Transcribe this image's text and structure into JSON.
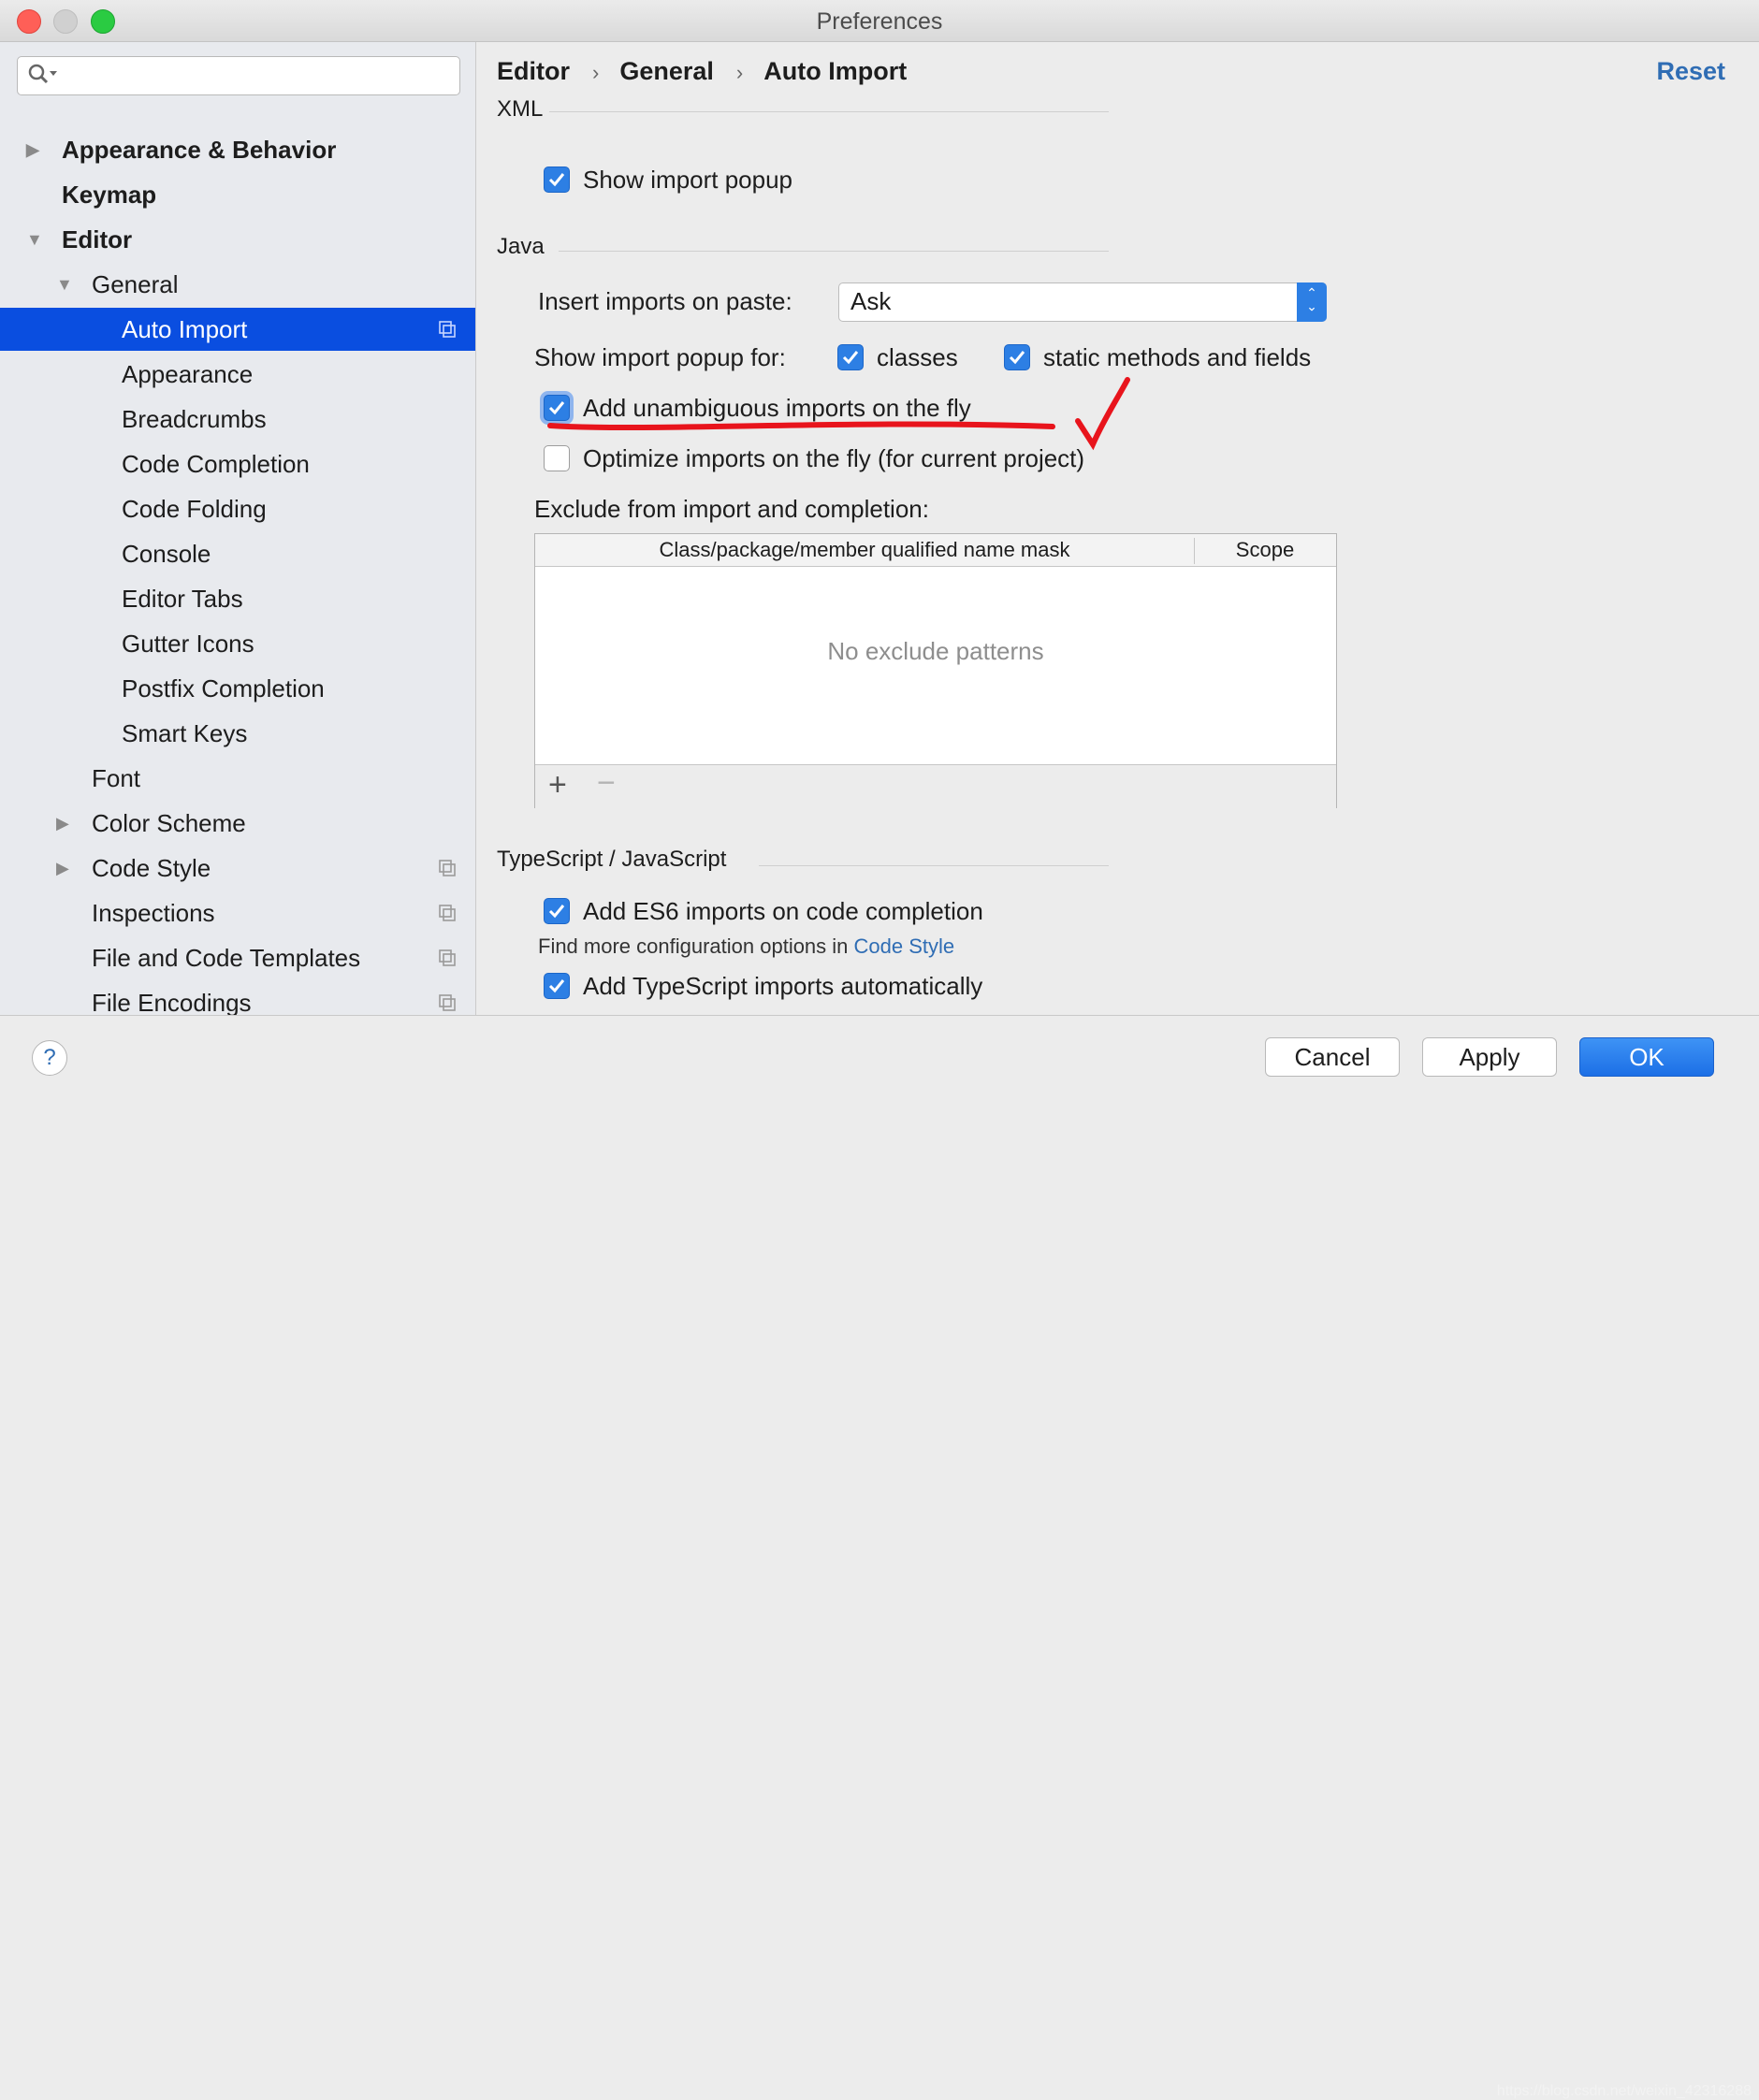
{
  "window": {
    "title": "Preferences"
  },
  "sidebar": {
    "search_placeholder": "",
    "items": [
      {
        "label": "Appearance & Behavior",
        "bold": true,
        "arrow": "right"
      },
      {
        "label": "Keymap",
        "bold": true
      },
      {
        "label": "Editor",
        "bold": true,
        "arrow": "down"
      },
      {
        "label": "General",
        "arrow": "down"
      },
      {
        "label": "Auto Import",
        "selected": true,
        "project_icon": true
      },
      {
        "label": "Appearance"
      },
      {
        "label": "Breadcrumbs"
      },
      {
        "label": "Code Completion"
      },
      {
        "label": "Code Folding"
      },
      {
        "label": "Console"
      },
      {
        "label": "Editor Tabs"
      },
      {
        "label": "Gutter Icons"
      },
      {
        "label": "Postfix Completion"
      },
      {
        "label": "Smart Keys"
      },
      {
        "label": "Font"
      },
      {
        "label": "Color Scheme",
        "arrow": "right"
      },
      {
        "label": "Code Style",
        "arrow": "right",
        "project_icon": true
      },
      {
        "label": "Inspections",
        "project_icon": true
      },
      {
        "label": "File and Code Templates",
        "project_icon": true
      },
      {
        "label": "File Encodings",
        "project_icon": true
      }
    ]
  },
  "breadcrumb": [
    "Editor",
    "General",
    "Auto Import"
  ],
  "reset_label": "Reset",
  "xml": {
    "section": "XML",
    "show_import_popup": {
      "label": "Show import popup",
      "checked": true
    }
  },
  "java": {
    "section": "Java",
    "insert_on_paste_label": "Insert imports on paste:",
    "insert_on_paste_value": "Ask",
    "popup_for_label": "Show import popup for:",
    "classes": {
      "label": "classes",
      "checked": true
    },
    "static_methods": {
      "label": "static methods and fields",
      "checked": true
    },
    "add_unambiguous": {
      "label": "Add unambiguous imports on the fly",
      "checked": true
    },
    "optimize": {
      "label": "Optimize imports on the fly (for current project)",
      "checked": false
    },
    "exclude_label": "Exclude from import and completion:",
    "table": {
      "columns": [
        "Class/package/member qualified name mask",
        "Scope"
      ],
      "empty_text": "No exclude patterns",
      "add": "+",
      "remove": "−"
    }
  },
  "typescript": {
    "section": "TypeScript / JavaScript",
    "es6": {
      "label": "Add ES6 imports on code completion",
      "checked": true
    },
    "note_prefix": "Find more configuration options in",
    "note_link": "Code Style",
    "ts_auto": {
      "label": "Add TypeScript imports automatically",
      "checked": true
    }
  },
  "buttons": {
    "help": "?",
    "cancel": "Cancel",
    "apply": "Apply",
    "ok": "OK"
  },
  "watermark": "https://blog.csdn.net/weixin_42316288",
  "colors": {
    "selection": "#0a4ee0",
    "checkbox": "#2d7fe4",
    "link": "#2f6db4",
    "annotation": "#e8141c"
  }
}
